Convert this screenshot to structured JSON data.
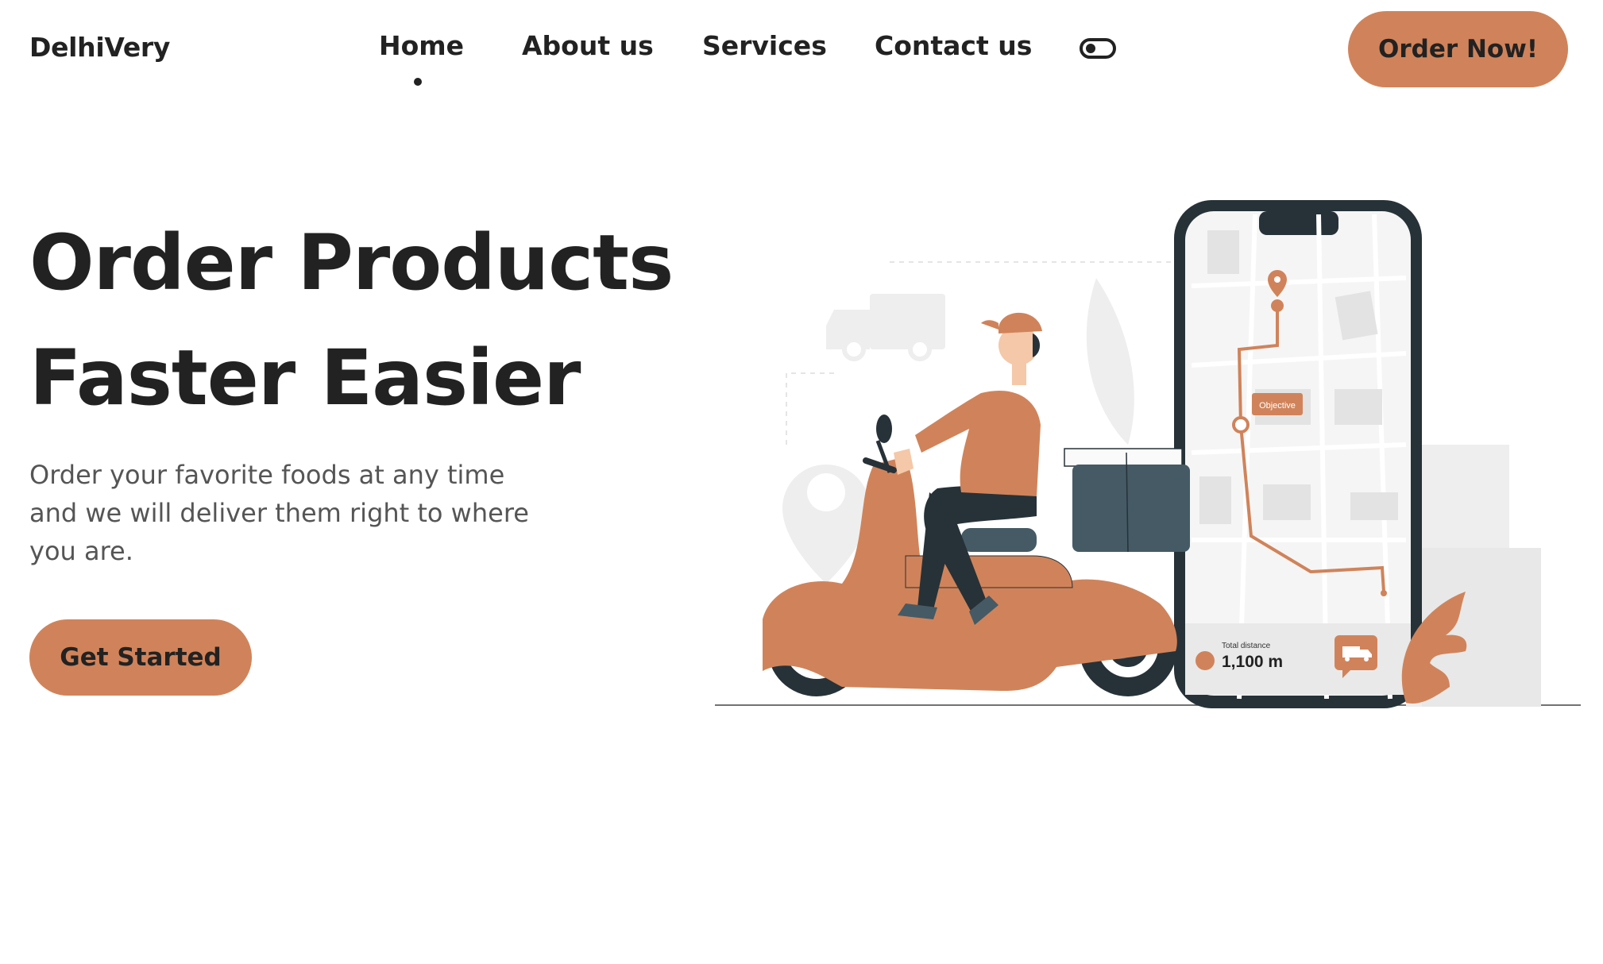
{
  "header": {
    "logo": "DelhiVery",
    "nav": [
      {
        "label": "Home",
        "active": true
      },
      {
        "label": "About us"
      },
      {
        "label": "Services"
      },
      {
        "label": "Contact us"
      }
    ],
    "theme_toggle_icon": "toggle-switch-icon",
    "order_button": "Order Now!"
  },
  "hero": {
    "title_line1": "Order Products",
    "title_line2": "Faster Easier",
    "subtitle": "Order your favorite foods at any time and we will deliver them right to where you are.",
    "cta": "Get Started"
  },
  "illustration": {
    "map_label": "Objective",
    "distance_caption": "Total distance",
    "distance_value": "1,100 m",
    "truck_icon": "delivery-truck-icon"
  },
  "colors": {
    "accent": "#d0835a",
    "text_dark": "#222222",
    "text_muted": "#555555",
    "phone_frame": "#263238",
    "box": "#455a64"
  }
}
